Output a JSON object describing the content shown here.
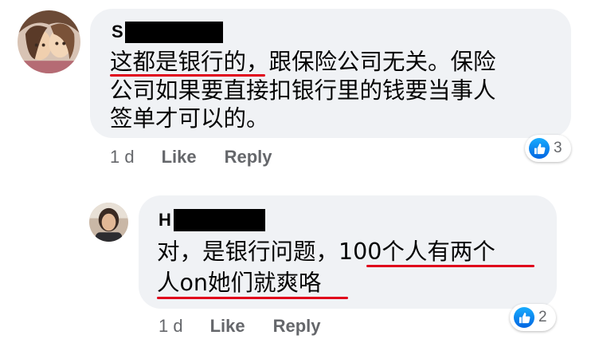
{
  "comments": [
    {
      "author_initial": "S",
      "text_lines": [
        "这都是银行的，跟保险公司无关。保险",
        "公司如果要直接扣银行里的钱要当事人",
        "签单才可以的。"
      ],
      "time": "1 d",
      "like_label": "Like",
      "reply_label": "Reply",
      "reaction_icon": "thumbs-up-icon",
      "reaction_count": "3"
    },
    {
      "author_initial": "H",
      "text_lines": [
        "对，是银行问题，100个人有两个",
        "人on她们就爽咯"
      ],
      "time": "1 d",
      "like_label": "Like",
      "reply_label": "Reply",
      "reaction_icon": "thumbs-up-icon",
      "reaction_count": "2"
    }
  ],
  "colors": {
    "bubble": "#f0f2f5",
    "meta_text": "#65676b",
    "underline": "#e0001b",
    "like_blue": "#1877f2"
  }
}
